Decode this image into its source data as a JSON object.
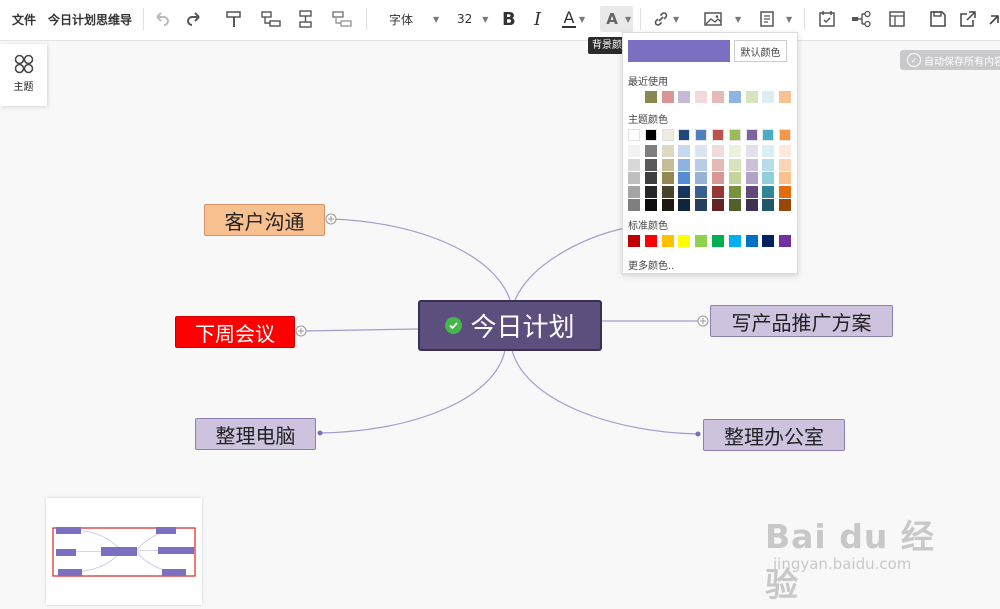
{
  "toolbar": {
    "file_label": "文件",
    "doc_title": "今日计划思维导",
    "font_label": "字体",
    "font_size": "32",
    "bold_glyph": "B",
    "italic_glyph": "I",
    "font_color_glyph": "A",
    "bg_color_glyph": "A",
    "font_color": "#333333",
    "bg_color_indicator": "#7a6fc0"
  },
  "tooltip": "背景颜色",
  "autosave_text": "自动保存所有内容",
  "theme_panel": {
    "label": "主题"
  },
  "mindmap": {
    "root": "今日计划",
    "nodes": [
      {
        "id": "customer",
        "label": "客户沟通",
        "fill": "#f8c08f",
        "border": "#d8956a"
      },
      {
        "id": "meeting",
        "label": "下周会议",
        "fill": "#ff0000",
        "border": "#cc0000",
        "text": "#ffffff"
      },
      {
        "id": "computer",
        "label": "整理电脑",
        "fill": "#cdc3de",
        "border": "#8b7fb4"
      },
      {
        "id": "promo",
        "label": "写产品推广方案",
        "fill": "#cdc3de",
        "border": "#8b7fb4"
      },
      {
        "id": "office",
        "label": "整理办公室",
        "fill": "#cdc3de",
        "border": "#8b7fb4"
      }
    ],
    "line_color": "#a59ad0"
  },
  "color_picker": {
    "current": "#7a6fc0",
    "default_label": "默认颜色",
    "recent_label": "最近使用",
    "recent": [
      "#8c8650",
      "#d99594",
      "#c6b8d8",
      "#f5d9d8",
      "#e6b8b8",
      "#8eb4e3",
      "#d7e4bd",
      "#dbeef3",
      "#fac090"
    ],
    "theme_label": "主题颜色",
    "theme_top": [
      "#ffffff",
      "#000000",
      "#eeece1",
      "#1f497d",
      "#4f81bd",
      "#c0504d",
      "#9bbb59",
      "#8064a2",
      "#4bacc6",
      "#f79646"
    ],
    "theme_shades": [
      [
        "#f2f2f2",
        "#7f7f7f",
        "#ddd9c3",
        "#c6d9f0",
        "#dbe5f1",
        "#f2dcdb",
        "#ebf1dd",
        "#e5e0ec",
        "#dbeef3",
        "#fdeada"
      ],
      [
        "#d8d8d8",
        "#595959",
        "#c4bd97",
        "#8db3e2",
        "#b8cce4",
        "#e5b9b7",
        "#d7e3bc",
        "#ccc1d9",
        "#b7dde8",
        "#fbd5b5"
      ],
      [
        "#bfbfbf",
        "#3f3f3f",
        "#938953",
        "#548dd4",
        "#95b3d7",
        "#d99694",
        "#c3d69b",
        "#b2a2c7",
        "#92cddc",
        "#fac08f"
      ],
      [
        "#a5a5a5",
        "#262626",
        "#494429",
        "#17365d",
        "#366092",
        "#953734",
        "#76923c",
        "#5f497a",
        "#31859b",
        "#e36c09"
      ],
      [
        "#7f7f7f",
        "#0c0c0c",
        "#1d1b10",
        "#0f243e",
        "#244061",
        "#632423",
        "#4f6128",
        "#3f3151",
        "#205867",
        "#974806"
      ]
    ],
    "standard_label": "标准颜色",
    "standard": [
      "#c00000",
      "#ff0000",
      "#ffc000",
      "#ffff00",
      "#92d050",
      "#00b050",
      "#00b0f0",
      "#0070c0",
      "#002060",
      "#7030a0"
    ],
    "more_label": "更多颜色.."
  },
  "watermark": {
    "brand": "Bai du 经验",
    "url": "jingyan.baidu.com"
  }
}
